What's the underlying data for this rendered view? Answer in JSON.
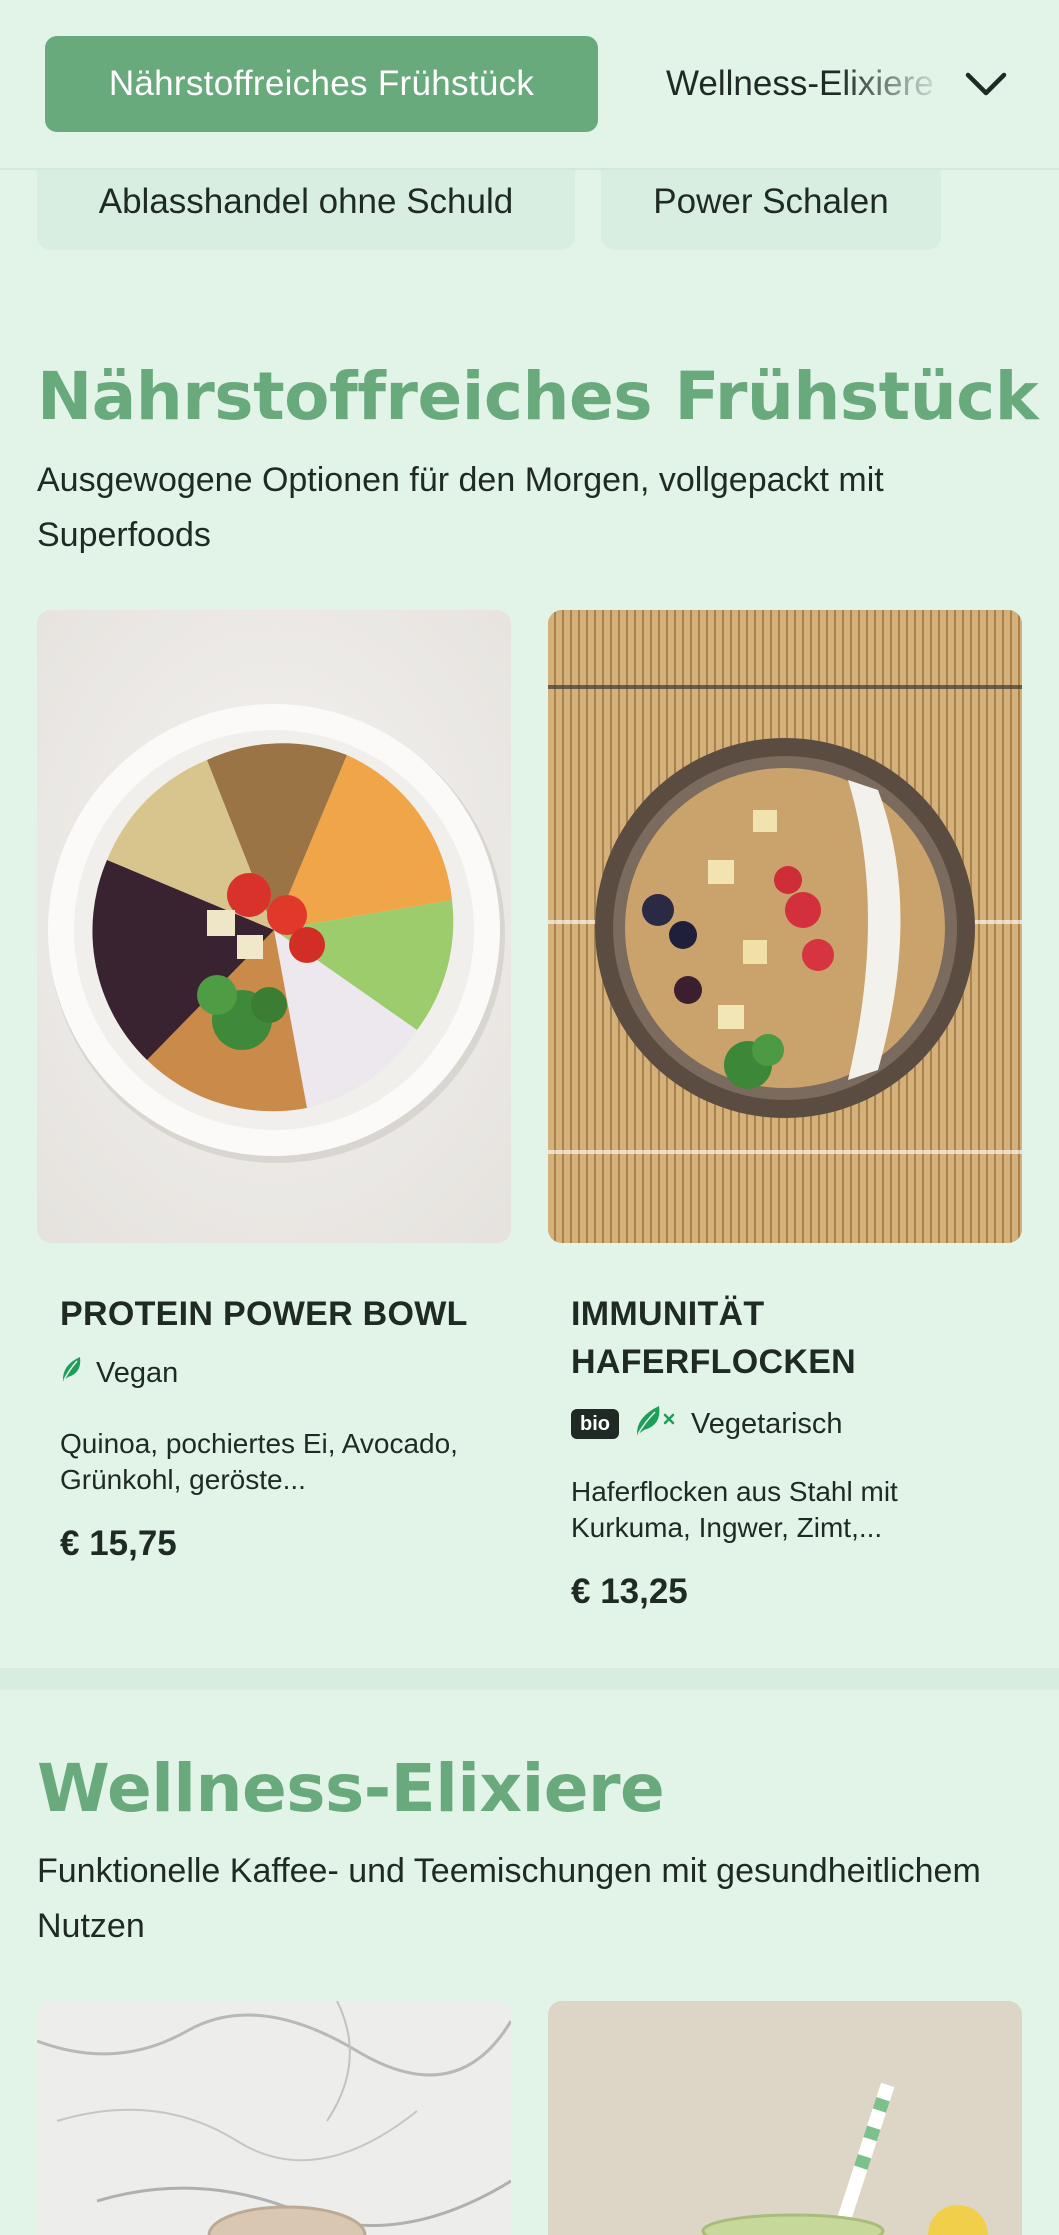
{
  "categories": {
    "active": "Nährstoffreiches Frühstück",
    "next": "Wellness-Elixiere",
    "chips": [
      "Ablasshandel ohne Schuld",
      "Power Schalen"
    ]
  },
  "sections": [
    {
      "title": "Nährstoffreiches Frühstück",
      "subtitle": "Ausgewogene Optionen für den Morgen, vollgepackt mit Superfoods",
      "items": [
        {
          "name": "PROTEIN POWER BOWL",
          "diet": "Vegan",
          "description": "Quinoa, pochiertes Ei, Avocado, Grünkohl, geröste...",
          "price": "€ 15,75"
        },
        {
          "name": "IMMUNITÄT HAFERFLOCKEN",
          "badge": "bio",
          "diet": "Vegetarisch",
          "description": "Haferflocken aus Stahl mit Kurkuma, Ingwer, Zimt,...",
          "price": "€ 13,25"
        }
      ]
    },
    {
      "title": "Wellness-Elixiere",
      "subtitle": "Funktionelle Kaffee- und Teemischungen mit gesundheitlichem Nutzen"
    }
  ],
  "colors": {
    "accent": "#69aa7d",
    "background": "#e2f3e8",
    "diet_icon": "#1f9e5a"
  }
}
